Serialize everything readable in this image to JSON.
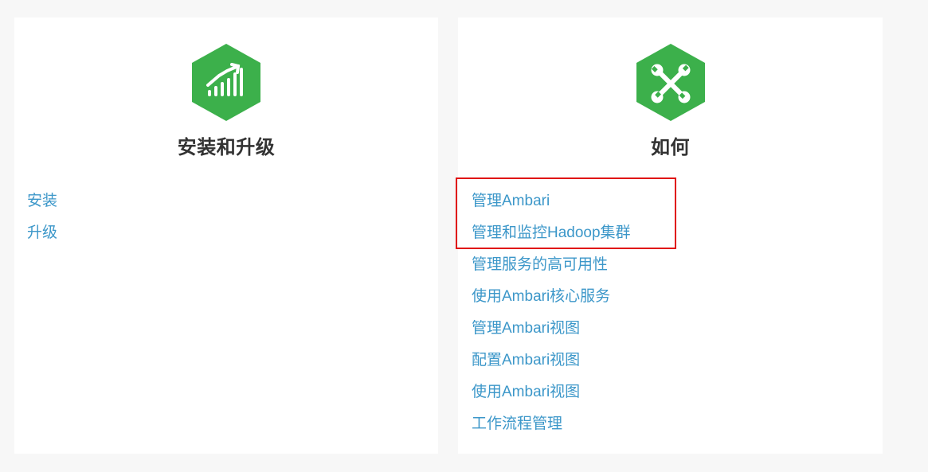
{
  "colors": {
    "page_background": "#f7f7f7",
    "card_background": "#ffffff",
    "icon_green": "#3cb04b",
    "link_blue": "#3c97c9",
    "title_text": "#333333",
    "highlight_red": "#e01010"
  },
  "cards": [
    {
      "icon": "chart-growth-icon",
      "title": "安装和升级",
      "links": [
        "安装",
        "升级"
      ]
    },
    {
      "icon": "wrench-cross-icon",
      "title": "如何",
      "links": [
        "管理Ambari",
        "管理和监控Hadoop集群",
        "管理服务的高可用性",
        "使用Ambari核心服务",
        "管理Ambari视图",
        "配置Ambari视图",
        "使用Ambari视图",
        "工作流程管理"
      ]
    }
  ]
}
